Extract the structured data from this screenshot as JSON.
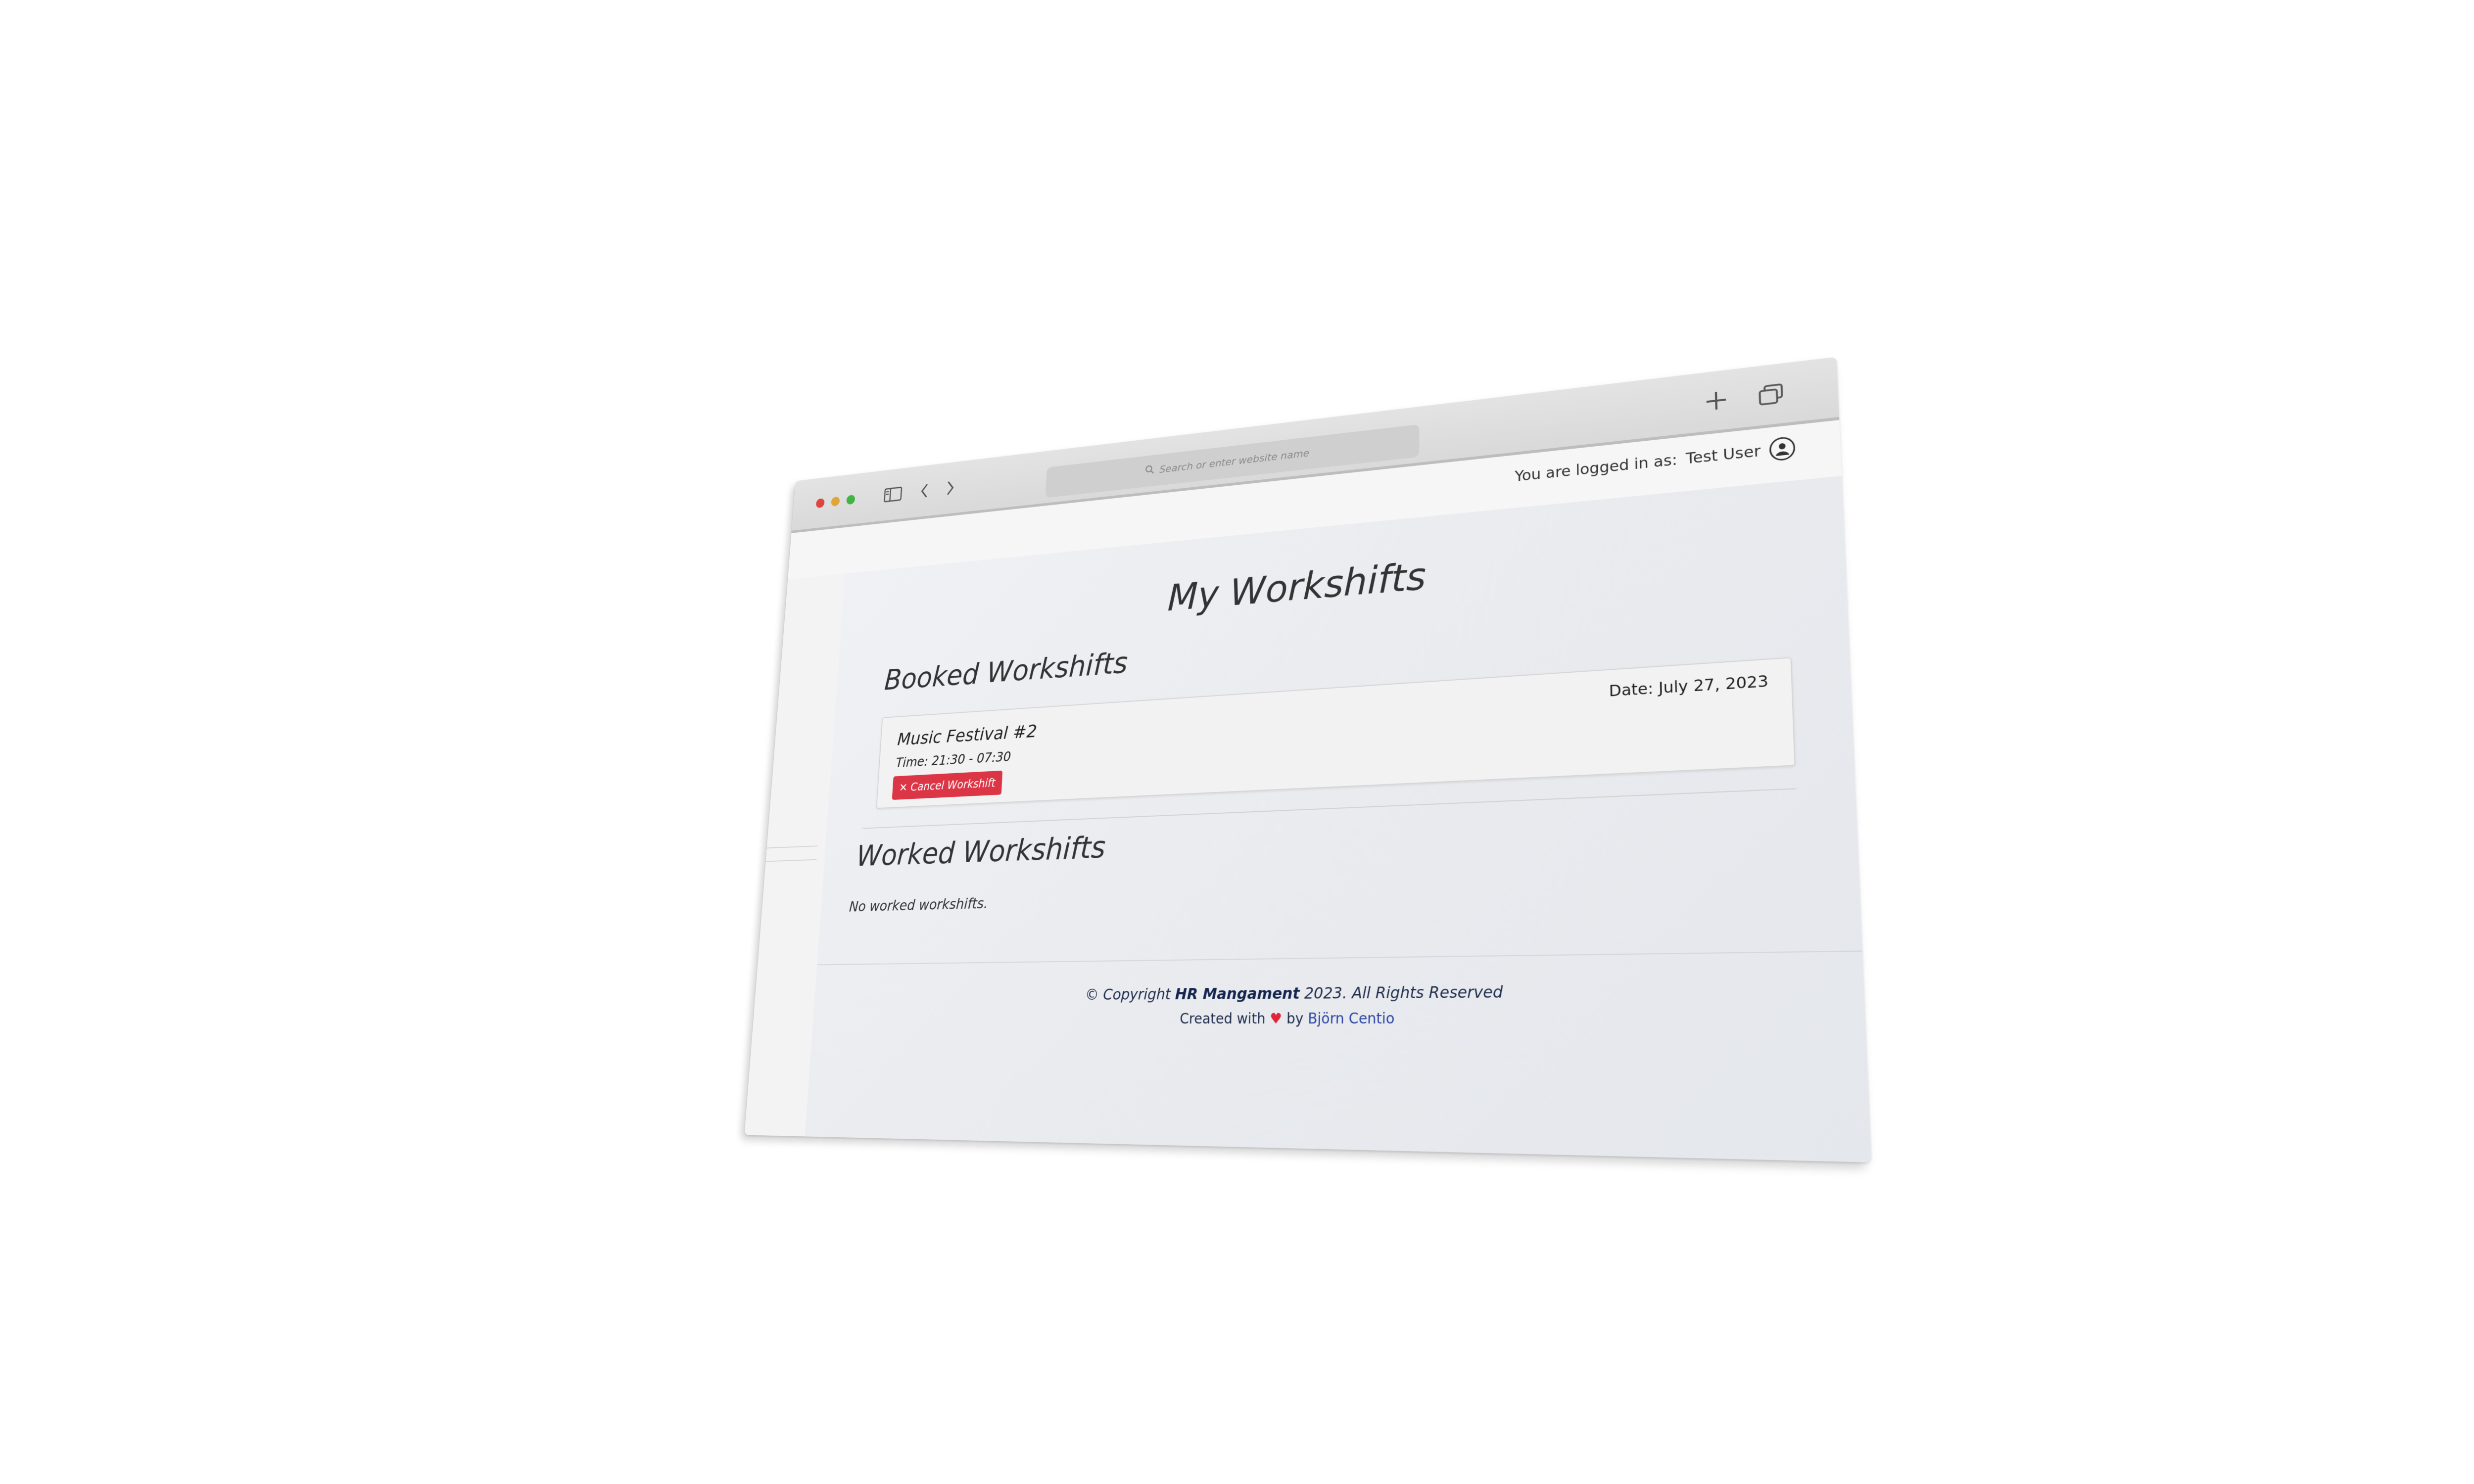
{
  "browser": {
    "address_placeholder": "Search or enter website name"
  },
  "topbar": {
    "login_prefix": "You are logged in as:",
    "user_name": "Test User"
  },
  "page": {
    "title": "My Workshifts"
  },
  "booked": {
    "title": "Booked Workshifts",
    "shifts": [
      {
        "name": "Music Festival #2",
        "date": "Date: July 27, 2023",
        "time": "Time: 21:30 - 07:30",
        "cancel_label": "Cancel Workshift"
      }
    ]
  },
  "worked": {
    "title": "Worked Workshifts",
    "empty_text": "No worked workshifts."
  },
  "footer": {
    "copyright_prefix": "© Copyright",
    "brand": "HR Mangament",
    "copyright_suffix": "2023. All Rights Reserved",
    "created_prefix": "Created with",
    "created_by": "by",
    "author": "Björn Centio"
  },
  "colors": {
    "cancel_button": "#dc3545",
    "heart": "#e0243a",
    "author_link": "#2d47a8",
    "traffic_red": "#e0443e",
    "traffic_yellow": "#e1a53a",
    "traffic_green": "#3fb543"
  },
  "icons": {
    "sidebar_toggle": "sidebar-icon",
    "back": "chevron-left-icon",
    "forward": "chevron-right-icon",
    "new_tab": "plus-icon",
    "tabs_overview": "tabs-icon",
    "search": "search-icon",
    "avatar": "user-avatar-icon",
    "cancel": "close-icon",
    "heart": "heart-icon"
  }
}
